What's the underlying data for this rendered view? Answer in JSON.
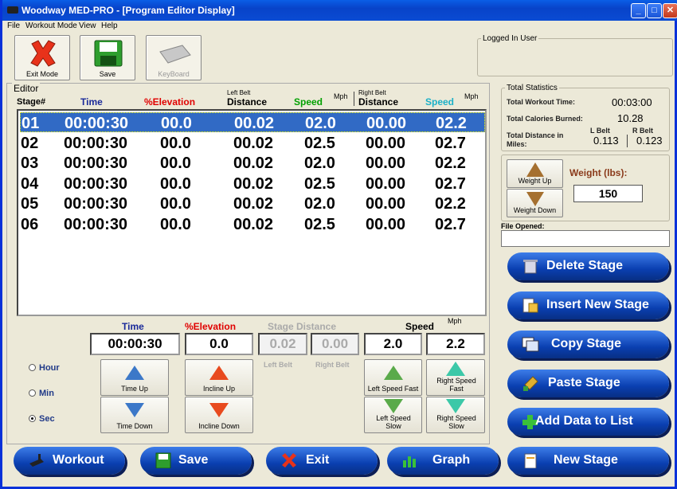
{
  "window": {
    "title": "Woodway MED-PRO - [Program Editor Display]"
  },
  "menu": [
    "File",
    "Workout Mode",
    "View",
    "Help"
  ],
  "toolbar": {
    "exit_label": "Exit Mode",
    "save_label": "Save",
    "keyboard_label": "KeyBoard"
  },
  "logged_in": {
    "label": "Logged In User",
    "value": ""
  },
  "editor": {
    "title": "Editor",
    "columns": {
      "stage": "Stage#",
      "time": "Time",
      "elevation": "%Elevation",
      "left_belt": "Left Belt",
      "distance1": "Distance",
      "speed1": "Speed",
      "mph1": "Mph",
      "right_belt": "Right Belt",
      "distance2": "Distance",
      "speed2": "Speed",
      "mph2": "Mph"
    },
    "rows": [
      [
        "01",
        "00:00:30",
        "00.0",
        "00.02",
        "02.0",
        "00.00",
        "02.2"
      ],
      [
        "02",
        "00:00:30",
        "00.0",
        "00.02",
        "02.5",
        "00.00",
        "02.7"
      ],
      [
        "03",
        "00:00:30",
        "00.0",
        "00.02",
        "02.0",
        "00.00",
        "02.2"
      ],
      [
        "04",
        "00:00:30",
        "00.0",
        "00.02",
        "02.5",
        "00.00",
        "02.7"
      ],
      [
        "05",
        "00:00:30",
        "00.0",
        "00.02",
        "02.0",
        "00.00",
        "02.2"
      ],
      [
        "06",
        "00:00:30",
        "00.0",
        "00.02",
        "02.5",
        "00.00",
        "02.7"
      ]
    ],
    "selected_row": 0
  },
  "inputs": {
    "time_label": "Time",
    "elevation_label": "%Elevation",
    "stage_distance_label": "Stage Distance",
    "speed_label": "Speed",
    "mph_label": "Mph",
    "time": "00:00:30",
    "elevation": "0.0",
    "left_distance": "0.02",
    "right_distance": "0.00",
    "left_speed": "2.0",
    "right_speed": "2.2",
    "left_belt": "Left Belt",
    "right_belt": "Right Belt"
  },
  "units": {
    "hour": "Hour",
    "min": "Min",
    "sec": "Sec",
    "selected": "sec"
  },
  "adjust": {
    "time_up": "Time Up",
    "time_down": "Time Down",
    "incline_up": "Incline Up",
    "incline_down": "Incline Down",
    "left_speed_fast": "Left Speed Fast",
    "right_speed_fast": "Right Speed Fast",
    "left_speed_slow": "Left Speed Slow",
    "right_speed_slow": "Right Speed Slow"
  },
  "stats": {
    "title": "Total Statistics",
    "workout_time_label": "Total Workout Time:",
    "workout_time": "00:03:00",
    "calories_label": "Total Calories Burned:",
    "calories": "10.28",
    "distance_label_1": "Total Distance in",
    "distance_label_2": "Miles:",
    "lbelt_label": "L Belt",
    "rbelt_label": "R Belt",
    "lbelt": "0.113",
    "rbelt": "0.123"
  },
  "weight": {
    "up_label": "Weight Up",
    "down_label": "Weight Down",
    "label": "Weight (lbs):",
    "value": "150"
  },
  "file": {
    "label": "File Opened:",
    "value": ""
  },
  "side_actions": [
    "Delete Stage",
    "Insert New Stage",
    "Copy Stage",
    "Paste Stage",
    "Add Data to List",
    "New Stage"
  ],
  "bottom_actions": [
    "Workout",
    "Save",
    "Exit",
    "Graph"
  ],
  "colors": {
    "title_blue": "#0a4bd3",
    "selection": "#316ac5",
    "elevation_red": "#e00000",
    "speed_green": "#00a000",
    "speed_cyan": "#1ab0c8",
    "time_blue": "#1a2a9a"
  }
}
